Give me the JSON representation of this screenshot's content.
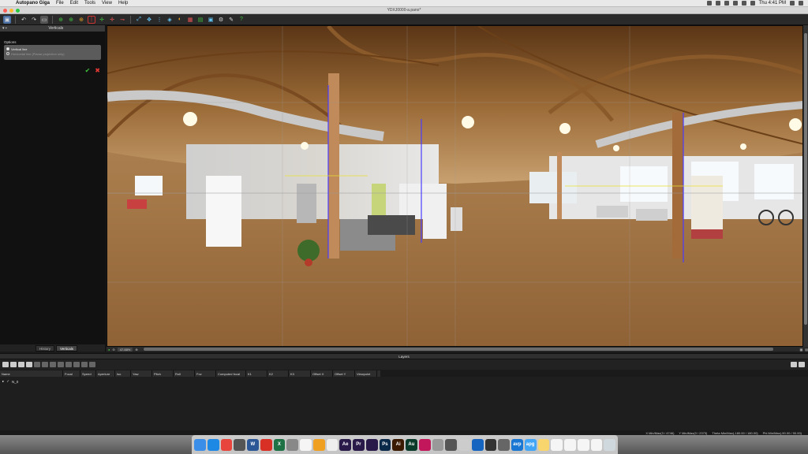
{
  "menubar": {
    "app_name": "Autopano Giga",
    "items": [
      "File",
      "Edit",
      "Tools",
      "View",
      "Help"
    ],
    "clock": "Thu 4:41 PM"
  },
  "window": {
    "title": "YDXJ0000-a.pano*"
  },
  "left_panel": {
    "title": "Verticals",
    "options_label": "Options",
    "vertical_line": "Vertical line",
    "horizontal_line": "Horizontal line (Planar projection only)",
    "tabs": [
      "History",
      "Verticals"
    ]
  },
  "viewport": {
    "zoom": "47.88%"
  },
  "layers": {
    "title": "Layers",
    "columns": [
      "Name",
      "Focal",
      "Speed",
      "Aperture",
      "Iso",
      "Yaw",
      "Pitch",
      "Roll",
      "Fov",
      "Computed focal",
      "K1",
      "K2",
      "K3",
      "Offset X",
      "Offset Y",
      "Viewpoint"
    ],
    "rows": [
      {
        "name": "N_0"
      }
    ]
  },
  "infobar": {
    "x": "X Min/Max(3 / 4746)",
    "y": "Y Min/Max(0 / 2373)",
    "theta": "Theta Min/Max(-180.00 / 180.00)",
    "phi": "Phi Min/Max(-90.00 / 90.00)"
  },
  "dock": {
    "apps": [
      {
        "icon": "finder-icon",
        "label": "",
        "color": "#3b8ee8"
      },
      {
        "icon": "appstore-icon",
        "label": "",
        "color": "#1e88e5"
      },
      {
        "icon": "chrome-icon",
        "label": "",
        "color": "#e8453c"
      },
      {
        "icon": "disk-icon",
        "label": "",
        "color": "#555555"
      },
      {
        "icon": "word-icon",
        "label": "W",
        "color": "#2b5797"
      },
      {
        "icon": "pdf-icon",
        "label": "",
        "color": "#d93025"
      },
      {
        "icon": "excel-icon",
        "label": "X",
        "color": "#1e7145"
      },
      {
        "icon": "settings-icon",
        "label": "",
        "color": "#888888"
      },
      {
        "icon": "notes-icon",
        "label": "",
        "color": "#f5f5f5"
      },
      {
        "icon": "autopano-icon",
        "label": "",
        "color": "#f0a020"
      },
      {
        "icon": "document-icon",
        "label": "",
        "color": "#eeeeee"
      },
      {
        "icon": "aftereffects-icon",
        "label": "Ae",
        "color": "#2a1a4a"
      },
      {
        "icon": "premiere-icon",
        "label": "Pr",
        "color": "#2a1a4a"
      },
      {
        "icon": "encoder-icon",
        "label": "",
        "color": "#2a1a4a"
      },
      {
        "icon": "photoshop-icon",
        "label": "Ps",
        "color": "#0b2a4a"
      },
      {
        "icon": "illustrator-icon",
        "label": "Ai",
        "color": "#3a1a00"
      },
      {
        "icon": "audition-icon",
        "label": "Au",
        "color": "#0a3a2a"
      },
      {
        "icon": "davinci-icon",
        "label": "",
        "color": "#c2185b"
      },
      {
        "icon": "printer-icon",
        "label": "",
        "color": "#999999"
      },
      {
        "icon": "viewer-icon",
        "label": "",
        "color": "#555555"
      },
      {
        "icon": "files-icon",
        "label": "",
        "color": "#cccccc"
      },
      {
        "icon": "globe-icon",
        "label": "",
        "color": "#1565c0"
      },
      {
        "icon": "camera-icon",
        "label": "",
        "color": "#333333"
      },
      {
        "icon": "monitor-icon",
        "label": "",
        "color": "#666666"
      },
      {
        "icon": "avp-icon",
        "label": "avp",
        "color": "#1976d2"
      },
      {
        "icon": "apg-icon",
        "label": "apg",
        "color": "#42a5f5"
      },
      {
        "icon": "folder-icon",
        "label": "",
        "color": "#f9d56e"
      },
      {
        "icon": "file-icon",
        "label": "",
        "color": "#f5f5f5"
      },
      {
        "icon": "file2-icon",
        "label": "",
        "color": "#f5f5f5"
      },
      {
        "icon": "file3-icon",
        "label": "",
        "color": "#f5f5f5"
      },
      {
        "icon": "file4-icon",
        "label": "",
        "color": "#f5f5f5"
      },
      {
        "icon": "trash-icon",
        "label": "",
        "color": "#cfd8dc"
      }
    ]
  }
}
